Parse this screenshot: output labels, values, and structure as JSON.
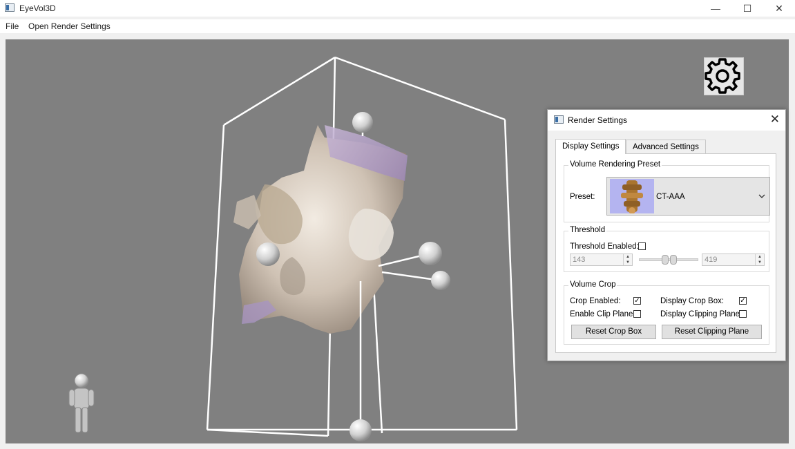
{
  "window": {
    "title": "EyeVol3D",
    "minimize_glyph": "—",
    "maximize_glyph": "☐",
    "close_glyph": "✕"
  },
  "menu": {
    "file": "File",
    "render_settings": "Open Render Settings"
  },
  "viewport": {
    "background": "#808080",
    "settings_icon": "gear-icon"
  },
  "render_settings": {
    "title": "Render Settings",
    "close_glyph": "✕",
    "tabs": [
      "Display Settings",
      "Advanced Settings"
    ],
    "active_tab": "Display Settings",
    "preset_group": {
      "title": "Volume Rendering Preset",
      "label": "Preset:",
      "value": "CT-AAA"
    },
    "threshold_group": {
      "title": "Threshold",
      "enabled_label": "Threshold Enabled:",
      "enabled": false,
      "min": "143",
      "max": "419"
    },
    "crop_group": {
      "title": "Volume Crop",
      "crop_enabled_label": "Crop Enabled:",
      "crop_enabled": true,
      "display_crop_box_label": "Display Crop Box:",
      "display_crop_box": true,
      "enable_clip_plane_label": "Enable Clip Plane:",
      "enable_clip_plane": false,
      "display_clipping_plane_label": "Display Clipping Plane:",
      "display_clipping_plane": false,
      "reset_crop_box": "Reset Crop Box",
      "reset_clipping_plane": "Reset Clipping Plane"
    },
    "check_glyph": "✓"
  }
}
